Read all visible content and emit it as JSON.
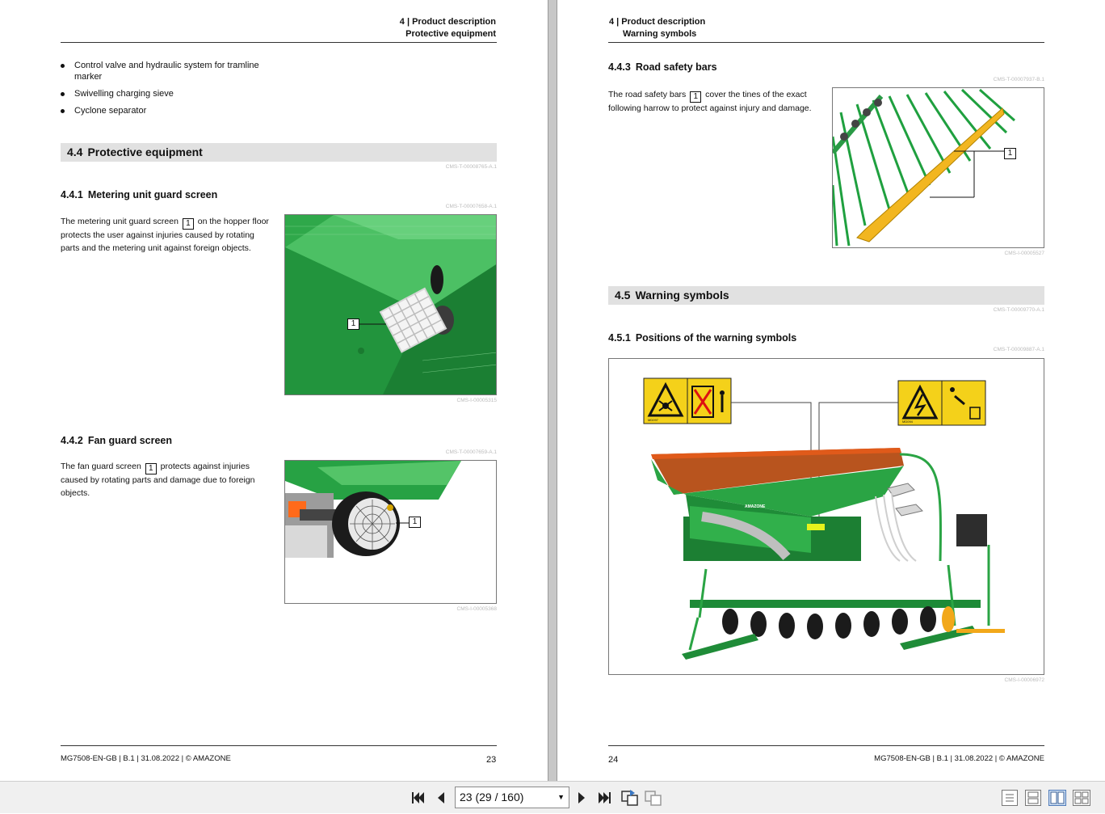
{
  "left_page": {
    "header": {
      "chapter": "4 | Product description",
      "section": "Protective equipment"
    },
    "bullets": [
      "Control valve and hydraulic system for tramline marker",
      "Swivelling charging sieve",
      "Cyclone separator"
    ],
    "section": {
      "num": "4.4",
      "title": "Protective equipment",
      "code": "CMS-T-00008765-A.1"
    },
    "sub1": {
      "num": "4.4.1",
      "title": "Metering unit guard screen",
      "code": "CMS-T-00007658-A.1",
      "text_a": "The metering unit guard screen",
      "callout": "1",
      "text_b": "on the hopper floor protects the user against injuries caused by rotating parts and the metering unit against foreign objects.",
      "fig_code": "CMS-I-00005315"
    },
    "sub2": {
      "num": "4.4.2",
      "title": "Fan guard screen",
      "code": "CMS-T-00007659-A.1",
      "text_a": "The fan guard screen",
      "callout": "1",
      "text_b": "protects against injuries caused by rotating parts and damage due to foreign objects.",
      "fig_code": "CMS-I-00005368"
    },
    "footer": "MG7508-EN-GB | B.1 | 31.08.2022 | © AMAZONE",
    "page_number": "23"
  },
  "right_page": {
    "header": {
      "chapter": "4 | Product description",
      "section": "Warning symbols"
    },
    "sub1": {
      "num": "4.4.3",
      "title": "Road safety bars",
      "code": "CMS-T-00007937-B.1",
      "text_a": "The road safety bars",
      "callout": "1",
      "text_b": "cover the tines of the exact following harrow to protect against injury and damage.",
      "fig_code": "CMS-I-00005527"
    },
    "section": {
      "num": "4.5",
      "title": "Warning symbols",
      "code": "CMS-T-00009770-A.1"
    },
    "sub2": {
      "num": "4.5.1",
      "title": "Positions of the warning symbols",
      "code": "CMS-T-00009887-A.1",
      "fig_code": "CMS-I-00006972",
      "machine_brand": "AMAZONE",
      "sign_left_code": "MD097",
      "sign_right_code": "MD094"
    },
    "footer": "MG7508-EN-GB | B.1 | 31.08.2022 | © AMAZONE",
    "page_number": "24"
  },
  "toolbar": {
    "page_field": "23 (29 / 160)",
    "icons": [
      "first-page-icon",
      "previous-page-icon",
      "next-page-icon",
      "last-page-icon",
      "previous-view-icon",
      "next-view-icon",
      "single-page-view-icon",
      "continuous-view-icon",
      "two-page-view-icon",
      "two-page-continuous-view-icon"
    ]
  },
  "colors": {
    "amazone_green": "#1e9a3c",
    "warning_yellow": "#f4d11a",
    "section_gray": "#e1e1e1"
  }
}
